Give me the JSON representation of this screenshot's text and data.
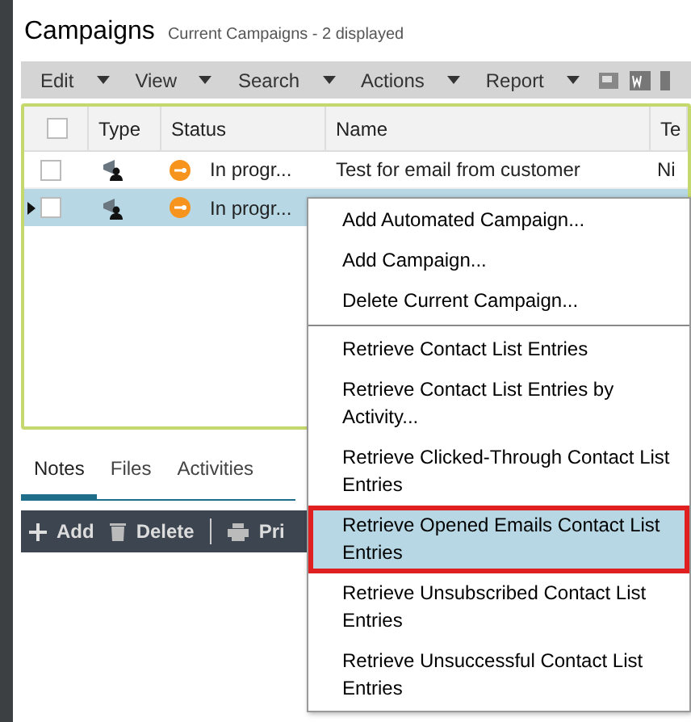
{
  "header": {
    "title": "Campaigns",
    "subtitle": "Current Campaigns - 2 displayed"
  },
  "toolbar": {
    "menus": [
      {
        "label": "Edit"
      },
      {
        "label": "View"
      },
      {
        "label": "Search"
      },
      {
        "label": "Actions"
      },
      {
        "label": "Report"
      }
    ]
  },
  "table": {
    "select_all_checked": false,
    "columns": [
      "Type",
      "Status",
      "Name",
      "Te"
    ],
    "rows": [
      {
        "selected": false,
        "checked": false,
        "status": "In progr...",
        "name": "Test for email from customer",
        "column_4": "Ni"
      },
      {
        "selected": true,
        "checked": false,
        "status": "In progr..."
      }
    ]
  },
  "tabs": [
    {
      "label": "Notes",
      "selected": true
    },
    {
      "label": "Files",
      "selected": false
    },
    {
      "label": "Activities",
      "selected": false
    }
  ],
  "bottom_toolbar": [
    {
      "kind": "add",
      "label": "Add"
    },
    {
      "kind": "delete",
      "label": "Delete"
    },
    {
      "kind": "print",
      "label": "Pri"
    }
  ],
  "context_menu": [
    {
      "kind": "item",
      "label": "Add Automated Campaign...",
      "selected": false
    },
    {
      "kind": "item",
      "label": "Add Campaign...",
      "selected": false
    },
    {
      "kind": "item",
      "label": "Delete Current Campaign...",
      "selected": false
    },
    {
      "kind": "separator"
    },
    {
      "kind": "item",
      "label": "Retrieve Contact List Entries",
      "selected": false
    },
    {
      "kind": "item",
      "label": "Retrieve Contact List Entries by Activity...",
      "selected": false
    },
    {
      "kind": "item",
      "label": "Retrieve Clicked-Through Contact List Entries",
      "selected": false
    },
    {
      "kind": "item",
      "label": "Retrieve Opened Emails Contact List Entries",
      "selected": true
    },
    {
      "kind": "item",
      "label": "Retrieve Unsubscribed Contact List Entries",
      "selected": false
    },
    {
      "kind": "item",
      "label": "Retrieve Unsuccessful Contact List Entries",
      "selected": false
    }
  ]
}
